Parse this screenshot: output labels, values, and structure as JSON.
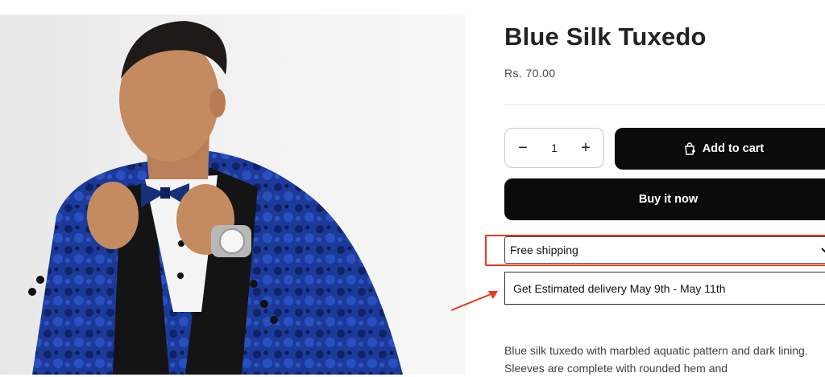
{
  "product": {
    "title": "Blue Silk Tuxedo",
    "price": "Rs. 70.00",
    "image_alt": "Man wearing a blue patterned silk tuxedo jacket adjusting a bow tie"
  },
  "quantity": {
    "decrease_symbol": "−",
    "value": "1",
    "increase_symbol": "+"
  },
  "buttons": {
    "add_to_cart": "Add to cart",
    "buy_now": "Buy it now"
  },
  "shipping": {
    "selected": "Free shipping"
  },
  "delivery": {
    "text": "Get Estimated delivery May 9th - May 11th"
  },
  "description": {
    "text": "Blue silk tuxedo with marbled aquatic pattern and dark lining. Sleeves are complete with rounded hem and"
  },
  "icons": {
    "cart": "shopping-bag-icon",
    "chevron": "chevron-down-icon",
    "annotation": "arrow-icon"
  },
  "colors": {
    "button_bg": "#0b0b0b",
    "annotation": "#e8391c",
    "jacket": "#1f3d9c"
  }
}
